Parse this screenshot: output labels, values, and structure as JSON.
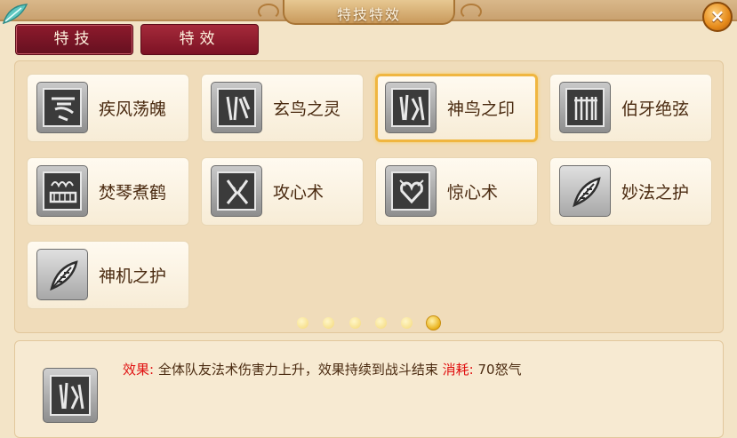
{
  "window": {
    "title": "特技特效",
    "close_symbol": "×"
  },
  "tabs": [
    {
      "label": "特技",
      "active": true
    },
    {
      "label": "特效",
      "active": false
    }
  ],
  "skills": [
    {
      "name": "疾风荡魄",
      "icon": "wind-rune-icon"
    },
    {
      "name": "玄鸟之灵",
      "icon": "bird-rune-icon"
    },
    {
      "name": "神鸟之印",
      "icon": "divine-bird-rune-icon",
      "selected": true
    },
    {
      "name": "伯牙绝弦",
      "icon": "zither-rune-icon"
    },
    {
      "name": "焚琴煮鹤",
      "icon": "burning-zither-icon"
    },
    {
      "name": "攻心术",
      "icon": "heart-attack-rune-icon"
    },
    {
      "name": "惊心术",
      "icon": "heart-shock-rune-icon"
    },
    {
      "name": "妙法之护",
      "icon": "feather-icon"
    },
    {
      "name": "神机之护",
      "icon": "feather-icon"
    }
  ],
  "pagination": {
    "total": 6,
    "current": 6
  },
  "description": {
    "effect_label": "效果:",
    "effect_text": "全体队友法术伤害力上升，效果持续到战斗结束",
    "cost_label": "消耗:",
    "cost_text": "70怒气"
  },
  "colors": {
    "tab_bg": "#8e1a2c",
    "selected_border": "#f0b640",
    "label_red": "#e01010",
    "background": "#f3e4c7"
  }
}
